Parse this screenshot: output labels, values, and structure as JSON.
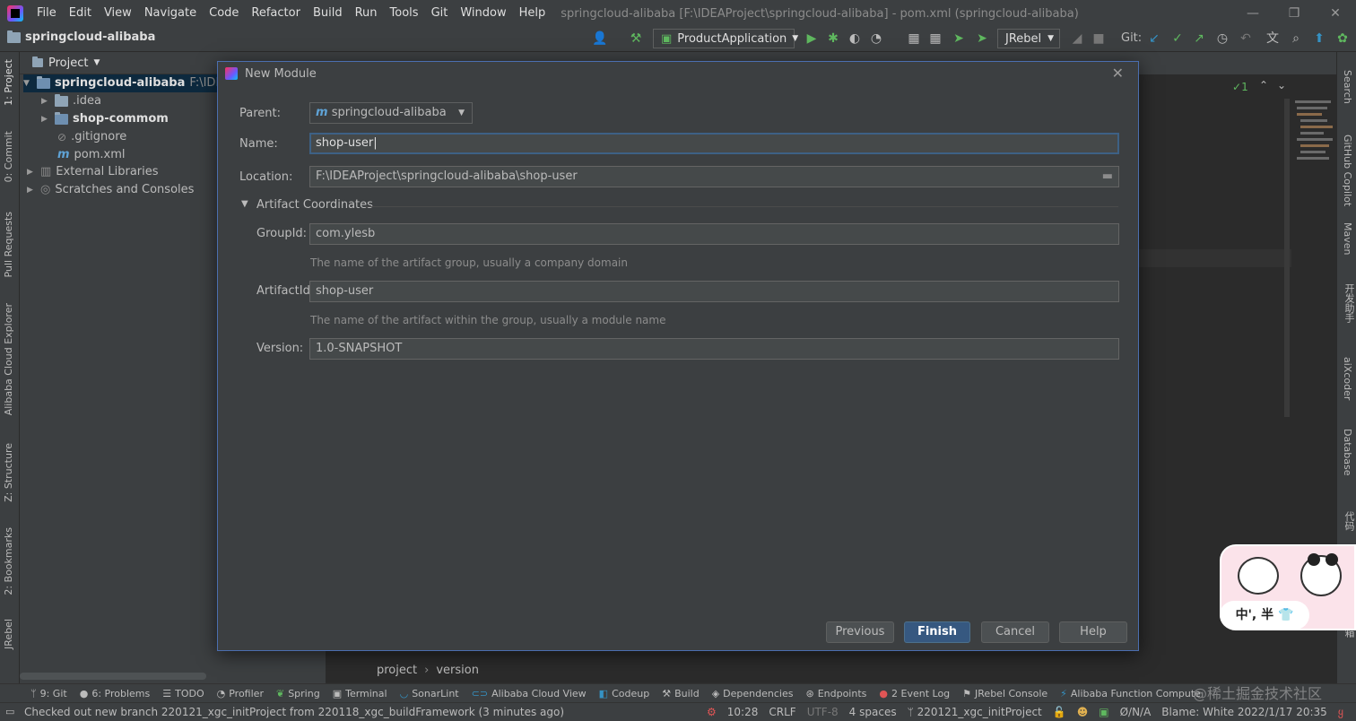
{
  "menubar": {
    "items": [
      "File",
      "Edit",
      "View",
      "Navigate",
      "Code",
      "Refactor",
      "Build",
      "Run",
      "Tools",
      "Git",
      "Window",
      "Help"
    ],
    "title": "springcloud-alibaba [F:\\IDEAProject\\springcloud-alibaba] - pom.xml (springcloud-alibaba)"
  },
  "toolbar": {
    "project_name": "springcloud-alibaba",
    "run_config": "ProductApplication",
    "jrebel": "JRebel",
    "git_label": "Git:"
  },
  "left_tools": [
    "1: Project",
    "0: Commit",
    "Pull Requests",
    "Alibaba Cloud Explorer",
    "Z: Structure",
    "2: Bookmarks",
    "JRebel"
  ],
  "right_tools": [
    "Search",
    "GitHub Copilot",
    "Maven",
    "开发助手",
    "aiXcoder",
    "Database",
    "代码",
    "工具箱"
  ],
  "project_panel": {
    "header": "Project",
    "root": "springcloud-alibaba",
    "root_path": "F:\\IDEA",
    "items": [
      ".idea",
      "shop-commom",
      ".gitignore",
      "pom.xml"
    ],
    "external": "External Libraries",
    "scratches": "Scratches and Consoles"
  },
  "dialog": {
    "title": "New Module",
    "parent_label": "Parent:",
    "parent_value": "springcloud-alibaba",
    "name_label": "Name:",
    "name_value": "shop-user",
    "location_label": "Location:",
    "location_value": "F:\\IDEAProject\\springcloud-alibaba\\shop-user",
    "artifact_section": "Artifact Coordinates",
    "groupid_label": "GroupId:",
    "groupid_value": "com.ylesb",
    "groupid_hint": "The name of the artifact group, usually a company domain",
    "artifactid_label": "ArtifactId:",
    "artifactid_value": "shop-user",
    "artifactid_hint": "The name of the artifact within the group, usually a module name",
    "version_label": "Version:",
    "version_value": "1.0-SNAPSHOT",
    "buttons": {
      "previous": "Previous",
      "finish": "Finish",
      "cancel": "Cancel",
      "help": "Help"
    }
  },
  "editor": {
    "breadcrumbs": [
      "project",
      "version"
    ],
    "inspection_count": "1"
  },
  "bottom_tools": [
    "9: Git",
    "6: Problems",
    "TODO",
    "Profiler",
    "Spring",
    "Terminal",
    "SonarLint",
    "Alibaba Cloud View",
    "Codeup",
    "Build",
    "Dependencies",
    "Endpoints",
    "2 Event Log",
    "JRebel Console",
    "Alibaba Function Compute"
  ],
  "statusbar": {
    "message": "Checked out new branch 220121_xgc_initProject from 220118_xgc_buildFramework (3 minutes ago)",
    "position": "10:28",
    "line_sep": "CRLF",
    "encoding": "UTF-8",
    "indent": "4 spaces",
    "branch": "220121_xgc_initProject",
    "na": "Ø/N/A",
    "blame": "Blame: White 2022/1/17 20:35"
  },
  "sticker": {
    "text": "中', 半 👕"
  },
  "watermark": "@稀土掘金技术社区"
}
